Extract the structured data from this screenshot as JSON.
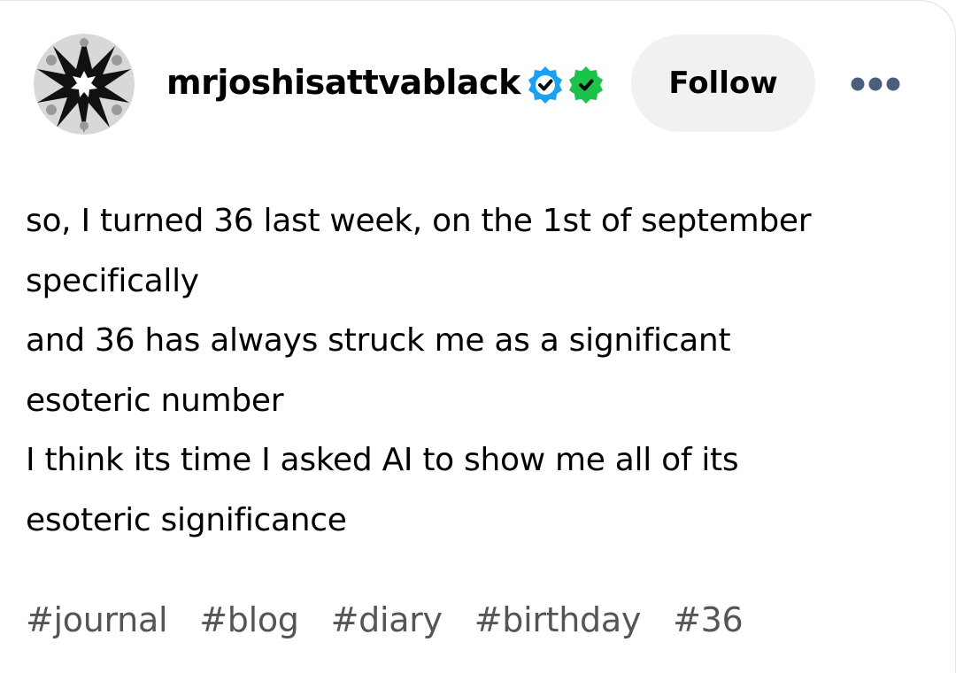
{
  "post": {
    "username": "mrjoshisattvablack",
    "follow_label": "Follow",
    "badges": [
      {
        "icon": "blue-verified-badge-icon",
        "color": "#1aa0f0"
      },
      {
        "icon": "green-verified-badge-icon",
        "color": "#1cc24a"
      }
    ],
    "more_icon": "more-options-icon",
    "lines": [
      "so, I turned 36 last week, on the 1st of september",
      "specifically",
      "and 36 has always struck me as a significant",
      "esoteric number",
      "I think its time I asked AI to show me all of its",
      "esoteric significance"
    ],
    "tags": [
      "#journal",
      "#blog",
      "#diary",
      "#birthday",
      "#36"
    ]
  },
  "colors": {
    "text": "#000000",
    "tag": "#555555",
    "follow_bg": "#f1f1f2",
    "more_dots": "#4a5f7a"
  }
}
